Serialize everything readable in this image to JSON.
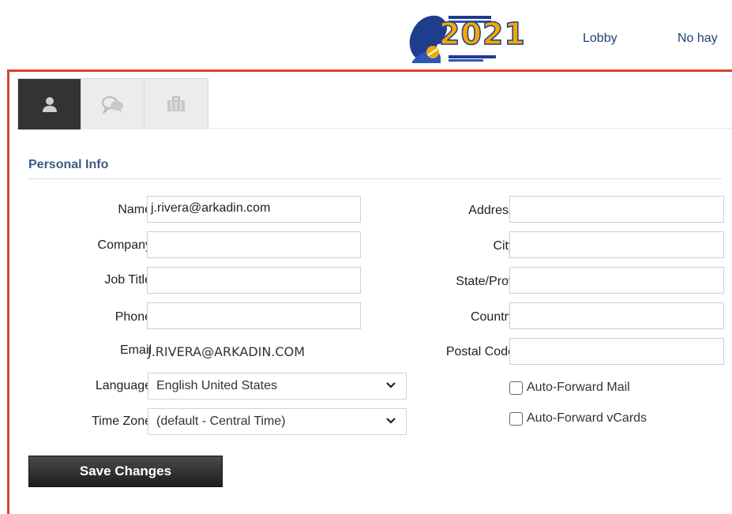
{
  "header": {
    "logo_year": "2021",
    "nav": {
      "lobby": "Lobby",
      "nohay": "No hay"
    }
  },
  "tabs": [
    {
      "icon": "person-icon",
      "active": true
    },
    {
      "icon": "chat-bubbles-icon",
      "active": false
    },
    {
      "icon": "briefcase-icon",
      "active": false
    }
  ],
  "section": {
    "title": "Personal Info"
  },
  "form": {
    "left": {
      "name_label": "Name",
      "name_value": "j.rivera@arkadin.com",
      "company_label": "Company",
      "company_value": "",
      "job_title_label": "Job Title",
      "job_title_value": "",
      "phone_label": "Phone",
      "phone_value": "",
      "email_label": "Email",
      "email_value": "J.RIVERA@ARKADIN.COM",
      "language_label": "Language",
      "language_value": "English United States",
      "timezone_label": "Time Zone",
      "timezone_value": "(default - Central Time)"
    },
    "right": {
      "address_label": "Address",
      "address_value": "",
      "city_label": "City",
      "city_value": "",
      "state_label": "State/Prov",
      "state_value": "",
      "country_label": "Country",
      "country_value": "",
      "postal_label": "Postal Code",
      "postal_value": "",
      "auto_forward_mail_label": "Auto-Forward Mail",
      "auto_forward_vcards_label": "Auto-Forward vCards"
    },
    "save_label": "Save Changes"
  },
  "colors": {
    "accent_border": "#d9432a",
    "section_title": "#3a5c84",
    "nav_text": "#1f3f73"
  }
}
